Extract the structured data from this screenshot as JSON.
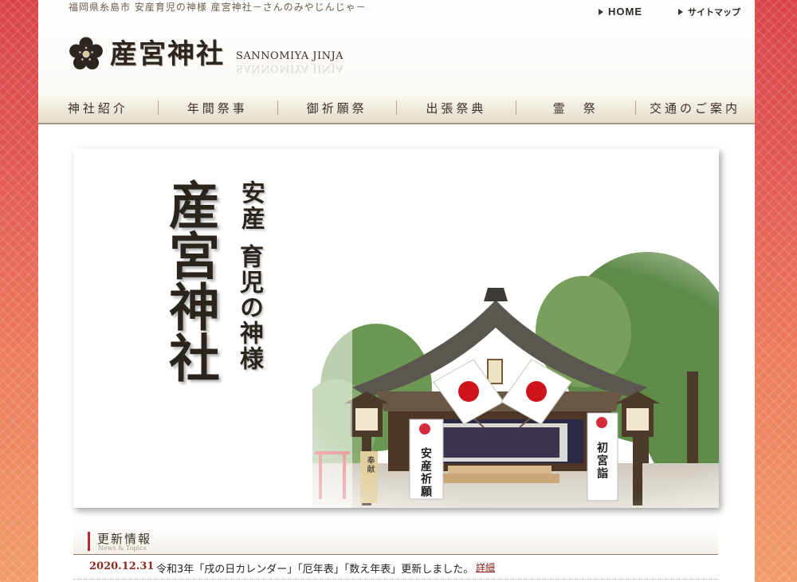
{
  "header": {
    "tagline": "福岡県糸島市 安産育児の神様 産宮神社－さんのみやじんじゃ－",
    "home_link": "HOME",
    "sitemap_link": "サイトマップ",
    "logo_title": "産宮神社",
    "logo_roman": "SANNOMIYA JINJA",
    "logo_icon": "plum-blossom-crest"
  },
  "nav": {
    "items": [
      {
        "label": "神社紹介"
      },
      {
        "label": "年間祭事"
      },
      {
        "label": "御祈願祭"
      },
      {
        "label": "出張祭典"
      },
      {
        "label": "霊　祭"
      },
      {
        "label": "交通のご案内"
      }
    ]
  },
  "hero": {
    "name": "産宮神社",
    "sub_line1": "安産",
    "sub_line2": "育児の神様",
    "banner_left": "安産祈願",
    "banner_right": "初宮詣",
    "lantern_label": "奉献",
    "colors": {
      "flag_red": "#d0141c",
      "banner_crest": "#d52b3a"
    }
  },
  "news": {
    "title": "更新情報",
    "subtitle": "News & Topics",
    "items": [
      {
        "date": "2020.12.31",
        "text": "令和3年「戌の日カレンダー」「厄年表」「数え年表」更新しました。",
        "link": "詳細"
      }
    ]
  },
  "colors": {
    "accent": "#b4282e",
    "background_gradient_top": "#d9444a",
    "background_gradient_bottom": "#f19c6a",
    "date_color": "#8c2b1e"
  }
}
